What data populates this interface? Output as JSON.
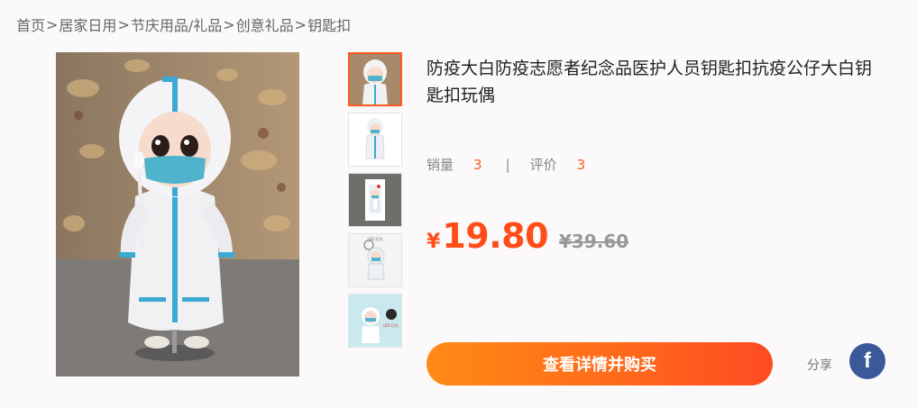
{
  "breadcrumb": {
    "items": [
      "首页",
      "居家日用",
      "节庆用品/礼品",
      "创意礼品",
      "钥匙扣"
    ],
    "separator": ">"
  },
  "product": {
    "title": "防疫大白防疫志愿者纪念品医护人员钥匙扣抗疫公仔大白钥匙扣玩偶",
    "sales_label": "销量",
    "sales_value": "3",
    "reviews_label": "评价",
    "reviews_value": "3",
    "divider": "|",
    "currency": "¥",
    "price": "19.80",
    "original_price": "¥39.60"
  },
  "gallery": {
    "selected_index": 0,
    "thumbnail_count": 5,
    "thumb4_caption": "LED 灯光",
    "thumb5_caption": "LED 灯光"
  },
  "actions": {
    "buy_label": "查看详情并购买",
    "share_label": "分享",
    "facebook_glyph": "f"
  },
  "colors": {
    "accent": "#ff4d1a",
    "button_gradient_start": "#ff8a16",
    "button_gradient_end": "#ff4b22",
    "facebook": "#3b5998"
  }
}
